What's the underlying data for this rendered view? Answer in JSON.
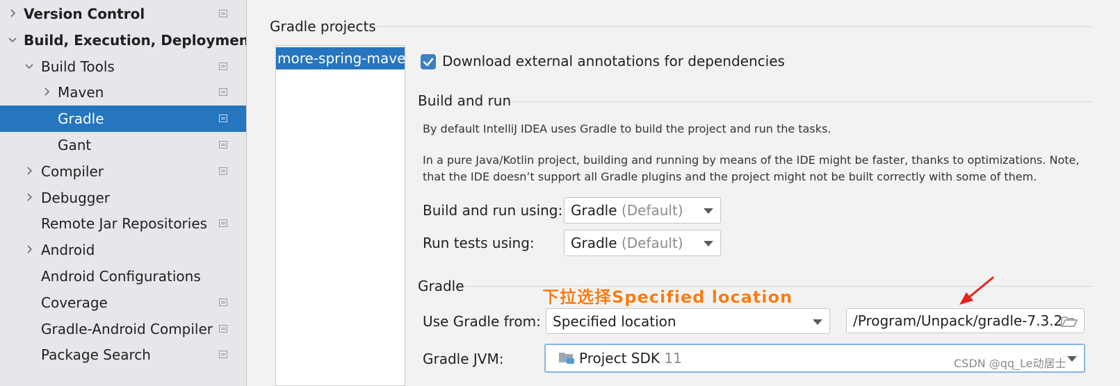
{
  "sidebar": {
    "items": [
      {
        "label": "Version Control",
        "level": 0,
        "expander": "collapsed",
        "bold": true,
        "project_icon": true,
        "selected": false
      },
      {
        "label": "Build, Execution, Deployment",
        "level": 0,
        "expander": "expanded",
        "bold": true,
        "project_icon": false,
        "selected": false
      },
      {
        "label": "Build Tools",
        "level": 1,
        "expander": "expanded",
        "bold": false,
        "project_icon": true,
        "selected": false
      },
      {
        "label": "Maven",
        "level": 2,
        "expander": "collapsed",
        "bold": false,
        "project_icon": true,
        "selected": false
      },
      {
        "label": "Gradle",
        "level": 2,
        "expander": "none",
        "bold": false,
        "project_icon": true,
        "selected": true
      },
      {
        "label": "Gant",
        "level": 2,
        "expander": "none",
        "bold": false,
        "project_icon": true,
        "selected": false
      },
      {
        "label": "Compiler",
        "level": 1,
        "expander": "collapsed",
        "bold": false,
        "project_icon": true,
        "selected": false
      },
      {
        "label": "Debugger",
        "level": 1,
        "expander": "collapsed",
        "bold": false,
        "project_icon": false,
        "selected": false
      },
      {
        "label": "Remote Jar Repositories",
        "level": 1,
        "expander": "none",
        "bold": false,
        "project_icon": true,
        "selected": false
      },
      {
        "label": "Android",
        "level": 1,
        "expander": "collapsed",
        "bold": false,
        "project_icon": false,
        "selected": false
      },
      {
        "label": "Android Configurations",
        "level": 1,
        "expander": "none",
        "bold": false,
        "project_icon": false,
        "selected": false
      },
      {
        "label": "Coverage",
        "level": 1,
        "expander": "none",
        "bold": false,
        "project_icon": true,
        "selected": false
      },
      {
        "label": "Gradle-Android Compiler",
        "level": 1,
        "expander": "none",
        "bold": false,
        "project_icon": true,
        "selected": false
      },
      {
        "label": "Package Search",
        "level": 1,
        "expander": "none",
        "bold": false,
        "project_icon": true,
        "selected": false
      }
    ]
  },
  "main": {
    "gradle_projects_title": "Gradle projects",
    "project_item": "more-spring-maven",
    "download_annotations": {
      "label": "Download external annotations for dependencies",
      "checked": true
    },
    "build_and_run": {
      "title": "Build and run",
      "desc1": "By default IntelliJ IDEA uses Gradle to build the project and run the tasks.",
      "desc2": "In a pure Java/Kotlin project, building and running by means of the IDE might be faster, thanks to optimizations. Note,",
      "desc3": "that the IDE doesn’t support all Gradle plugins and the project might not be built correctly with some of them.",
      "build_run_using_label": "Build and run using:",
      "build_run_using_value": "Gradle",
      "build_run_using_hint": "(Default)",
      "run_tests_label": "Run tests using:",
      "run_tests_value": "Gradle",
      "run_tests_hint": "(Default)"
    },
    "gradle": {
      "title": "Gradle",
      "use_gradle_from_label": "Use Gradle from:",
      "use_gradle_from_value": "Specified location",
      "gradle_home_path": "/Program/Unpack/gradle-7.3.2",
      "gradle_jvm_label": "Gradle JVM:",
      "gradle_jvm_value": "Project SDK",
      "gradle_jvm_version": "11"
    }
  },
  "annotation": {
    "text": "下拉选择Specified location",
    "color": "#ff7a14",
    "arrow_color": "#e8201a"
  },
  "watermark": "CSDN @qq_Le动居士",
  "colors": {
    "selection": "#2675bf",
    "checkbox": "#3c7fc5",
    "sidebar_bg": "#e6e7ea",
    "main_bg": "#f2f2f2"
  }
}
